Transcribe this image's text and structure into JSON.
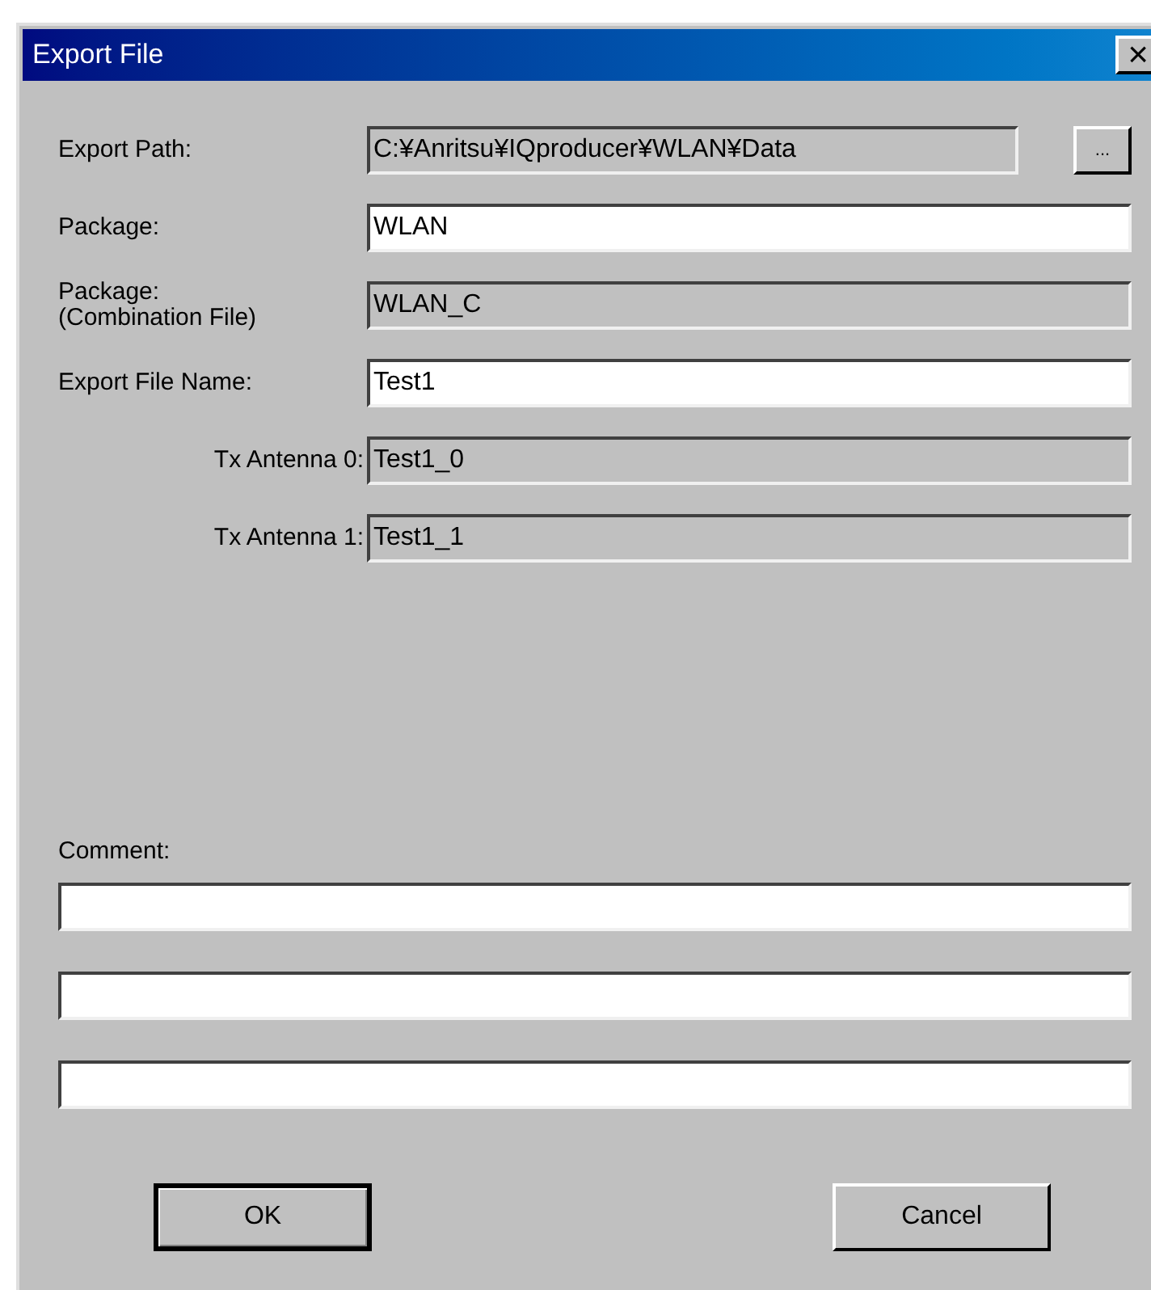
{
  "window": {
    "title": "Export File",
    "close": "×"
  },
  "fields": [
    {
      "label": "Export Path:",
      "value": "C:¥Anritsu¥IQproducer¥WLAN¥Data",
      "enabled": false,
      "browse": "..."
    },
    {
      "label": "Package:",
      "value": "WLAN",
      "enabled": true
    },
    {
      "label": "Package:\n(Combination File)",
      "value": "WLAN_C",
      "enabled": false
    },
    {
      "label": "Export File Name:",
      "value": "Test1",
      "enabled": true
    },
    {
      "label": "Tx Antenna 0:",
      "value": "Test1_0",
      "enabled": false,
      "indent": true
    },
    {
      "label": "Tx Antenna 1:",
      "value": "Test1_1",
      "enabled": false,
      "indent": true
    }
  ],
  "comment": {
    "label": "Comment:",
    "lines": [
      {
        "enabled": true
      },
      {
        "enabled": true
      },
      {
        "enabled": true
      }
    ]
  },
  "buttons": [
    {
      "label": "OK",
      "default": true
    },
    {
      "label": "Cancel",
      "default": false
    }
  ]
}
